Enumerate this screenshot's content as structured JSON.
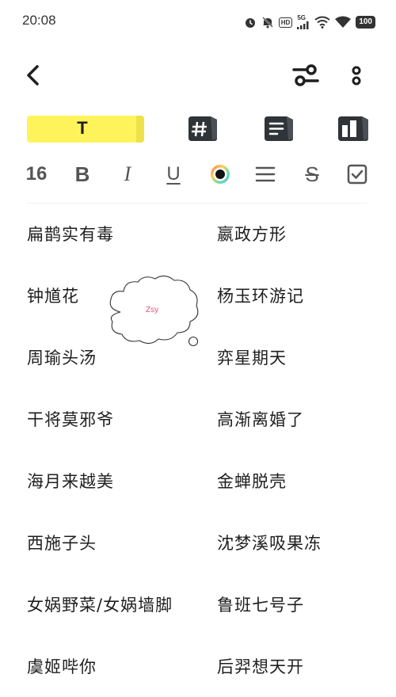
{
  "status_bar": {
    "time": "20:08",
    "network_label": "5G",
    "hd_label": "HD",
    "battery": "100"
  },
  "toolbar_tabs": {
    "text_label": "T"
  },
  "format_bar": {
    "font_size": "16",
    "bold_label": "B",
    "italic_label": "I",
    "underline_label": "U",
    "strike_label": "S",
    "color_dot": "#111111"
  },
  "doodle": {
    "label": "Zsy"
  },
  "rows": [
    {
      "left": "扁鹊实有毒",
      "right": "嬴政方形"
    },
    {
      "left": "钟馗花",
      "right": "杨玉环游记"
    },
    {
      "left": "周瑜头汤",
      "right": "弈星期天"
    },
    {
      "left": "干将莫邪爷",
      "right": "高渐离婚了"
    },
    {
      "left": "海月来越美",
      "right": "金蝉脱壳"
    },
    {
      "left": "西施子头",
      "right": "沈梦溪吸果冻"
    },
    {
      "left": "女娲野菜/女娲墙脚",
      "right": "鲁班七号子"
    },
    {
      "left": "虞姬哔你",
      "right": "后羿想天开"
    }
  ],
  "colors": {
    "accent_yellow": "#fff35c",
    "icon_dark": "#2f3438"
  }
}
